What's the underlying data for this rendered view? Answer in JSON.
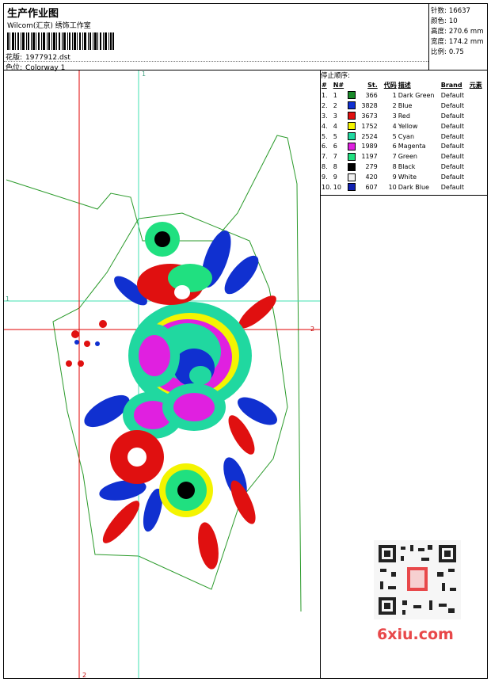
{
  "header": {
    "title": "生产作业图",
    "company": "Wilcom(汇京) 绣饰工作室",
    "pattern_label": "花版:",
    "pattern_value": "1977912.dst",
    "colorway_label": "色位:",
    "colorway_value": "Colorway 1"
  },
  "specs": [
    {
      "label": "针数:",
      "value": "16637"
    },
    {
      "label": "颜色:",
      "value": "10"
    },
    {
      "label": "高度:",
      "value": "270.6 mm"
    },
    {
      "label": "宽度:",
      "value": "174.2 mm"
    },
    {
      "label": "比例:",
      "value": "0.75"
    }
  ],
  "stop_sequence": {
    "title": "停止顺序:",
    "headers": [
      "#",
      "N#",
      "St.",
      "代码",
      "描述",
      "Brand",
      "元素"
    ],
    "rows": [
      {
        "idx": "1.",
        "n": "1",
        "color": "#1a8a2a",
        "st": "366",
        "code": "1",
        "desc": "Dark Green",
        "brand": "Default"
      },
      {
        "idx": "2.",
        "n": "2",
        "color": "#1030d0",
        "st": "3828",
        "code": "2",
        "desc": "Blue",
        "brand": "Default"
      },
      {
        "idx": "3.",
        "n": "3",
        "color": "#e01010",
        "st": "3673",
        "code": "3",
        "desc": "Red",
        "brand": "Default"
      },
      {
        "idx": "4.",
        "n": "4",
        "color": "#f4f400",
        "st": "1752",
        "code": "4",
        "desc": "Yellow",
        "brand": "Default"
      },
      {
        "idx": "5.",
        "n": "5",
        "color": "#20d8a0",
        "st": "2524",
        "code": "5",
        "desc": "Cyan",
        "brand": "Default"
      },
      {
        "idx": "6.",
        "n": "6",
        "color": "#e020e0",
        "st": "1989",
        "code": "6",
        "desc": "Magenta",
        "brand": "Default"
      },
      {
        "idx": "7.",
        "n": "7",
        "color": "#20e080",
        "st": "1197",
        "code": "7",
        "desc": "Green",
        "brand": "Default"
      },
      {
        "idx": "8.",
        "n": "8",
        "color": "#000000",
        "st": "279",
        "code": "8",
        "desc": "Black",
        "brand": "Default"
      },
      {
        "idx": "9.",
        "n": "9",
        "color": "#f0f0f0",
        "st": "420",
        "code": "9",
        "desc": "White",
        "brand": "Default"
      },
      {
        "idx": "10.",
        "n": "10",
        "color": "#1020b0",
        "st": "607",
        "code": "10",
        "desc": "Dark Blue",
        "brand": "Default"
      }
    ]
  },
  "guides": {
    "h1": "1",
    "h2": "2",
    "v1": "1",
    "v2": "2"
  },
  "colors": {
    "guide_red": "#e00000",
    "guide_cyan": "#40e0b0",
    "outline": "#2a9a2a",
    "watermark": "#e8484a"
  },
  "watermark": "6xiu.com"
}
